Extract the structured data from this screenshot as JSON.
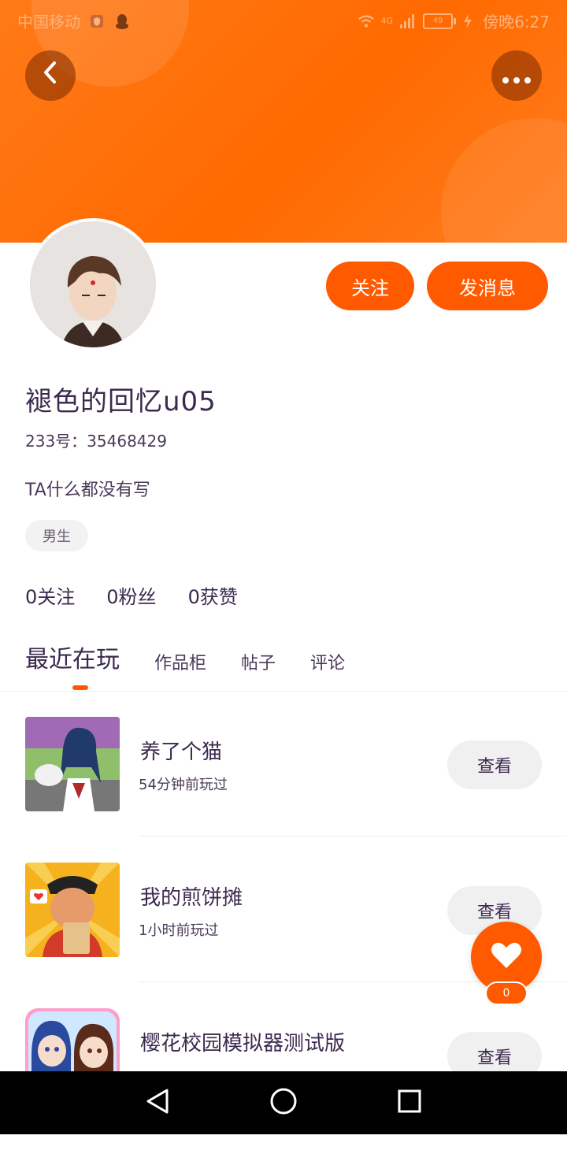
{
  "status_bar": {
    "carrier": "中国移动",
    "network": "4G",
    "battery": "49",
    "time": "傍晚6:27"
  },
  "profile": {
    "follow_label": "关注",
    "message_label": "发消息",
    "username": "褪色的回忆u05",
    "uid": "233号：35468429",
    "bio": "TA什么都没有写",
    "gender_tag": "男生",
    "stats": [
      {
        "label": "0关注"
      },
      {
        "label": "0粉丝"
      },
      {
        "label": "0获赞"
      }
    ]
  },
  "tabs": [
    {
      "label": "最近在玩",
      "active": true
    },
    {
      "label": "作品柜",
      "active": false
    },
    {
      "label": "帖子",
      "active": false
    },
    {
      "label": "评论",
      "active": false
    }
  ],
  "games": [
    {
      "title": "养了个猫",
      "time": "54分钟前玩过",
      "view_label": "查看"
    },
    {
      "title": "我的煎饼摊",
      "time": "1小时前玩过",
      "view_label": "查看"
    },
    {
      "title": "樱花校园模拟器测试版",
      "time": "",
      "view_label": "查看"
    }
  ],
  "like": {
    "count": "0"
  },
  "colors": {
    "accent": "#ff5a00",
    "header": "#ff6a00"
  },
  "icons": {
    "back": "chevron-left-icon",
    "more": "more-dots-icon",
    "like": "heart-icon",
    "nav_back": "triangle-back-icon",
    "nav_home": "circle-home-icon",
    "nav_recent": "square-recent-icon"
  }
}
